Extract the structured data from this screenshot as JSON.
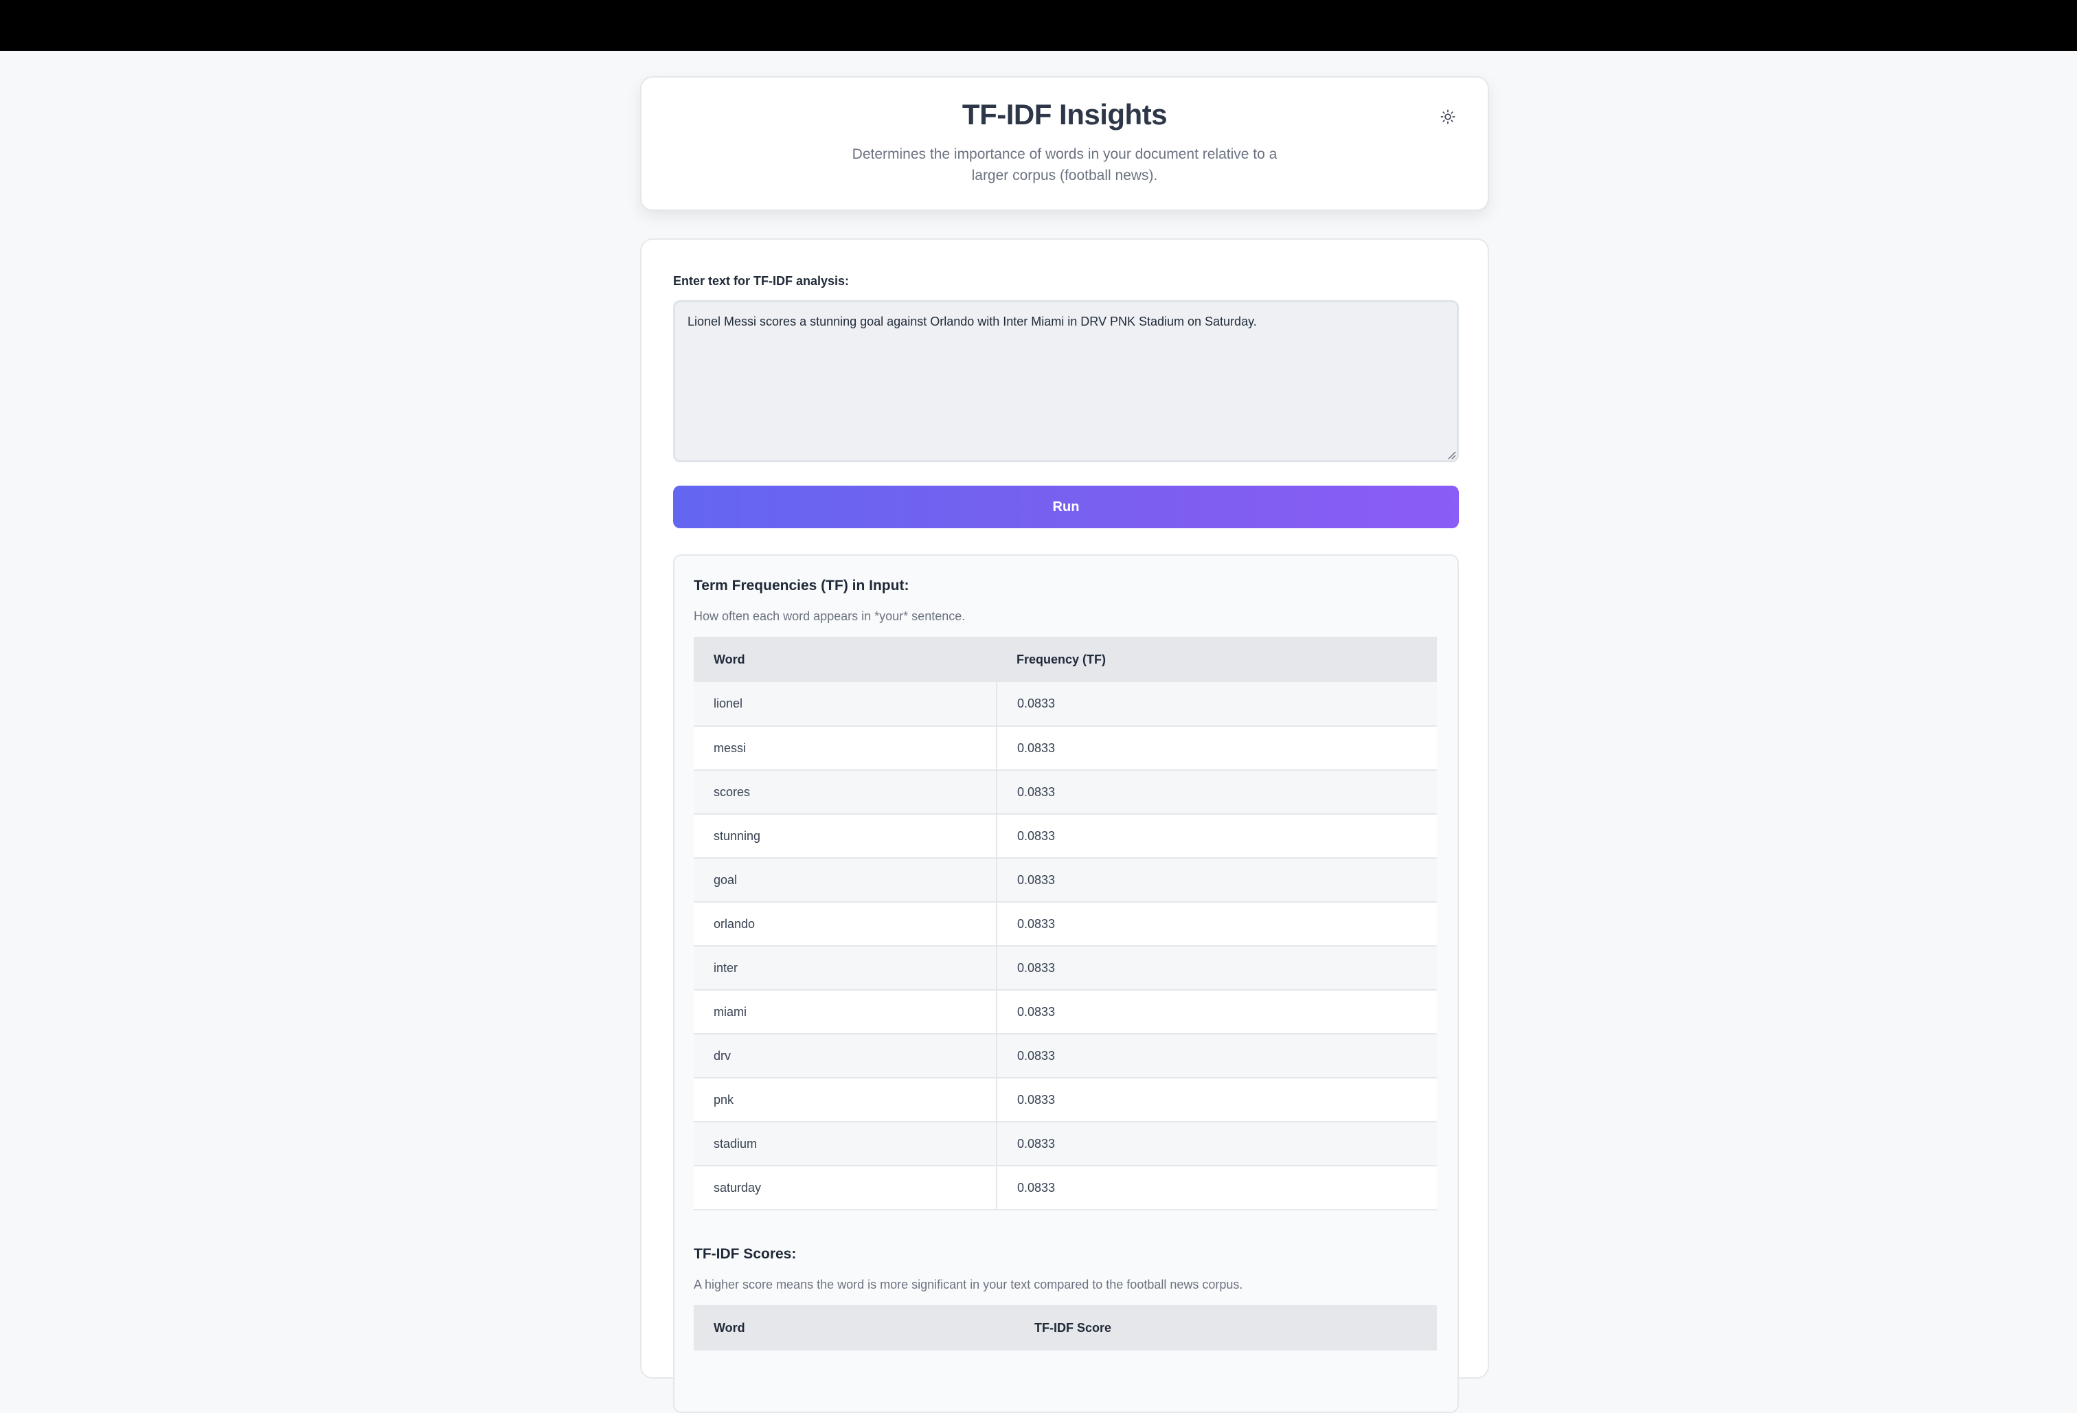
{
  "header": {
    "title": "TF-IDF Insights",
    "subtitle": "Determines the importance of words in your document relative to a larger corpus (football news).",
    "theme_toggle_icon": "sun-icon"
  },
  "input": {
    "label": "Enter text for TF-IDF analysis:",
    "value": "Lionel Messi scores a stunning goal against Orlando with Inter Miami in DRV PNK Stadium on Saturday."
  },
  "run_button": {
    "label": "Run"
  },
  "tf_section": {
    "title": "Term Frequencies (TF) in Input:",
    "description": "How often each word appears in *your* sentence.",
    "columns": [
      "Word",
      "Frequency (TF)"
    ],
    "rows": [
      {
        "word": "lionel",
        "value": "0.0833"
      },
      {
        "word": "messi",
        "value": "0.0833"
      },
      {
        "word": "scores",
        "value": "0.0833"
      },
      {
        "word": "stunning",
        "value": "0.0833"
      },
      {
        "word": "goal",
        "value": "0.0833"
      },
      {
        "word": "orlando",
        "value": "0.0833"
      },
      {
        "word": "inter",
        "value": "0.0833"
      },
      {
        "word": "miami",
        "value": "0.0833"
      },
      {
        "word": "drv",
        "value": "0.0833"
      },
      {
        "word": "pnk",
        "value": "0.0833"
      },
      {
        "word": "stadium",
        "value": "0.0833"
      },
      {
        "word": "saturday",
        "value": "0.0833"
      }
    ]
  },
  "tfidf_section": {
    "title": "TF-IDF Scores:",
    "description": "A higher score means the word is more significant in your text compared to the football news corpus.",
    "columns": [
      "Word",
      "TF-IDF Score"
    ]
  },
  "colors": {
    "accent_start": "#6366f1",
    "accent_end": "#8b5cf6",
    "topbar": "#000000",
    "background": "#f7f8fa"
  }
}
